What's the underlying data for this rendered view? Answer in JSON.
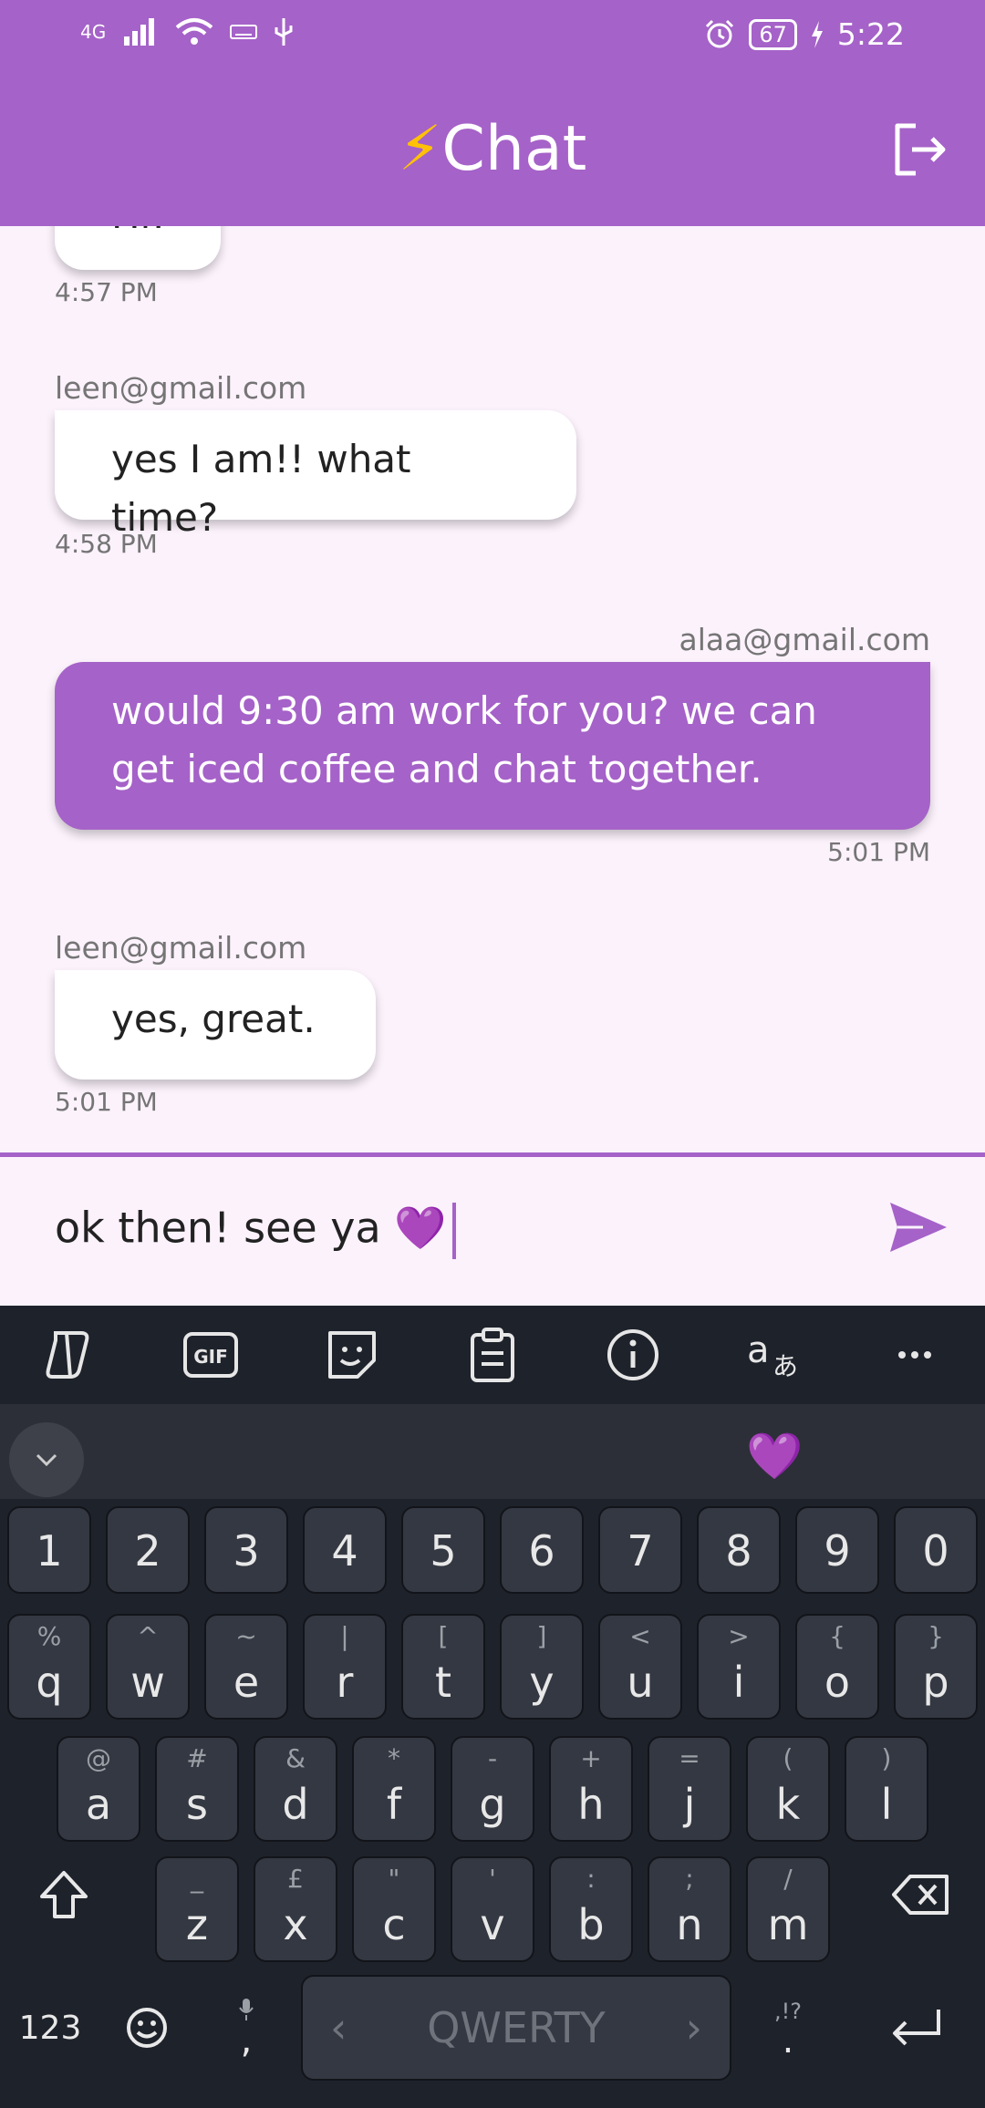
{
  "status_bar": {
    "network": "4G",
    "battery": "67",
    "time": "5:22"
  },
  "app_bar": {
    "bolt": "⚡",
    "title": "Chat"
  },
  "messages": [
    {
      "text": "Hi!",
      "time": "4:57 PM"
    },
    {
      "sender": "leen@gmail.com",
      "text": "yes I am!! what time?",
      "time": "4:58 PM"
    },
    {
      "sender": "alaa@gmail.com",
      "text": "would 9:30 am work for you? we can get iced coffee and chat together.",
      "time": "5:01 PM"
    },
    {
      "sender": "leen@gmail.com",
      "text": "yes, great.",
      "time": "5:01 PM"
    }
  ],
  "composer": {
    "value": "ok then! see ya 💜"
  },
  "keyboard": {
    "suggestion": "💜",
    "numbers": [
      "1",
      "2",
      "3",
      "4",
      "5",
      "6",
      "7",
      "8",
      "9",
      "0"
    ],
    "row1": [
      {
        "main": "q",
        "alt": "%"
      },
      {
        "main": "w",
        "alt": "^"
      },
      {
        "main": "e",
        "alt": "~"
      },
      {
        "main": "r",
        "alt": "|"
      },
      {
        "main": "t",
        "alt": "["
      },
      {
        "main": "y",
        "alt": "]"
      },
      {
        "main": "u",
        "alt": "<"
      },
      {
        "main": "i",
        "alt": ">"
      },
      {
        "main": "o",
        "alt": "{"
      },
      {
        "main": "p",
        "alt": "}"
      }
    ],
    "row2": [
      {
        "main": "a",
        "alt": "@"
      },
      {
        "main": "s",
        "alt": "#"
      },
      {
        "main": "d",
        "alt": "&"
      },
      {
        "main": "f",
        "alt": "*"
      },
      {
        "main": "g",
        "alt": "-"
      },
      {
        "main": "h",
        "alt": "+"
      },
      {
        "main": "j",
        "alt": "="
      },
      {
        "main": "k",
        "alt": "("
      },
      {
        "main": "l",
        "alt": ")"
      }
    ],
    "row3": [
      {
        "main": "z",
        "alt": "_"
      },
      {
        "main": "x",
        "alt": "£"
      },
      {
        "main": "c",
        "alt": "\""
      },
      {
        "main": "v",
        "alt": "'"
      },
      {
        "main": "b",
        "alt": ":"
      },
      {
        "main": "n",
        "alt": ";"
      },
      {
        "main": "m",
        "alt": "/"
      }
    ],
    "num_toggle": "123",
    "comma": ",",
    "space_label": "QWERTY",
    "period": ".",
    "period_alt": ",!?"
  }
}
